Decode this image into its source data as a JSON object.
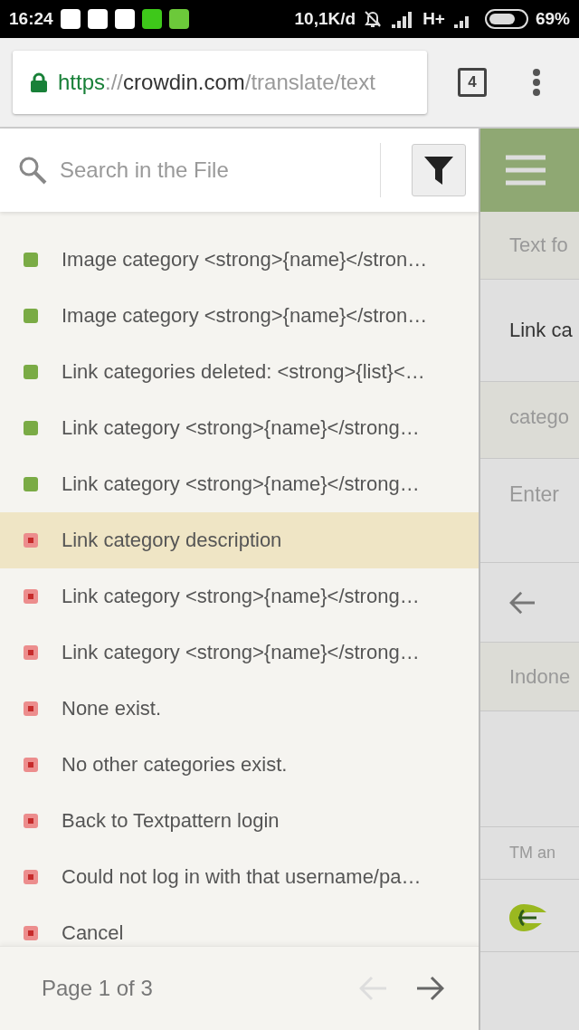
{
  "status_bar": {
    "time": "16:24",
    "speed": "10,1K/d",
    "network": "H+",
    "battery": "69%"
  },
  "browser": {
    "url_scheme": "https",
    "url_sep": "://",
    "url_host": "crowdin.com",
    "url_path": "/translate/text",
    "tab_count": "4"
  },
  "search": {
    "placeholder": "Search in the File"
  },
  "strings": [
    {
      "text": "Image category <strong>{name}</stron…",
      "translated": true,
      "selected": false
    },
    {
      "text": "Image category <strong>{name}</stron…",
      "translated": true,
      "selected": false
    },
    {
      "text": "Link categories deleted: <strong>{list}<…",
      "translated": true,
      "selected": false
    },
    {
      "text": "Link category <strong>{name}</strong…",
      "translated": true,
      "selected": false
    },
    {
      "text": "Link category <strong>{name}</strong…",
      "translated": true,
      "selected": false
    },
    {
      "text": "Link category description",
      "translated": false,
      "selected": true
    },
    {
      "text": "Link category <strong>{name}</strong…",
      "translated": false,
      "selected": false
    },
    {
      "text": "Link category <strong>{name}</strong…",
      "translated": false,
      "selected": false
    },
    {
      "text": "None exist.",
      "translated": false,
      "selected": false
    },
    {
      "text": "No other categories exist.",
      "translated": false,
      "selected": false
    },
    {
      "text": "Back to Textpattern login",
      "translated": false,
      "selected": false
    },
    {
      "text": "Could not log in with that username/pa…",
      "translated": false,
      "selected": false
    },
    {
      "text": "Cancel",
      "translated": false,
      "selected": false
    }
  ],
  "pager": {
    "label": "Page 1 of 3",
    "prev_disabled": true,
    "next_disabled": false
  },
  "editor": {
    "context": "Text fo",
    "source": "Link ca",
    "tag": "catego",
    "placeholder": "Enter",
    "language": "Indone",
    "footer": "TM an"
  }
}
